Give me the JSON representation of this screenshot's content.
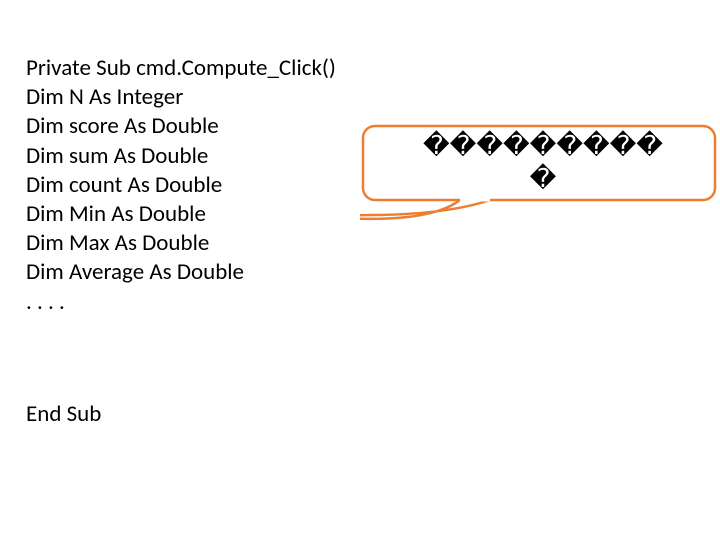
{
  "code": {
    "l1": "Private Sub cmd.Compute_Click()",
    "l2": "Dim N As Integer",
    "l3": "Dim score As Double",
    "l4": "Dim sum As Double",
    "l5": "Dim count As Double",
    "l6": "Dim Min As Double",
    "l7": "Dim Max As Double",
    "l8": "Dim Average As Double",
    "l9": ". . . .",
    "end": "End Sub"
  },
  "callout": {
    "line1": "���������",
    "line2": "�",
    "border_color": "#ED7D31",
    "border_width": 2
  }
}
